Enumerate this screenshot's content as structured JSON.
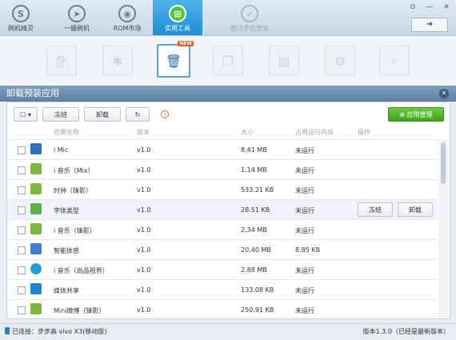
{
  "nav": {
    "items": [
      {
        "label": "刷机精灵"
      },
      {
        "label": "一键刷机"
      },
      {
        "label": "ROM市场"
      },
      {
        "label": "实用工具"
      },
      {
        "label": "腾讯手机管家"
      }
    ]
  },
  "panel": {
    "title": "卸载预装应用",
    "freeze_label": "冻结",
    "uninstall_label": "卸载",
    "manage_label": "应用管理"
  },
  "table": {
    "headers": [
      "应用名称",
      "版本",
      "大小",
      "占用运行内存",
      "操作"
    ],
    "rows": [
      {
        "name": "i Mic",
        "version": "v1.0",
        "size": "8.41 MB",
        "memory": "未运行"
      },
      {
        "name": "i 音乐（Mix）",
        "version": "v1.0",
        "size": "1.14 MB",
        "memory": "未运行"
      },
      {
        "name": "时钟（锋影）",
        "version": "v1.0",
        "size": "533.21 KB",
        "memory": "未运行"
      },
      {
        "name": "字体类型",
        "version": "v1.0",
        "size": "28.51 KB",
        "memory": "未运行",
        "freeze": "冻结",
        "uninstall": "卸载"
      },
      {
        "name": "i 音乐（锋影）",
        "version": "v1.0",
        "size": "2.34 MB",
        "memory": "未运行"
      },
      {
        "name": "智能体感",
        "version": "v1.0",
        "size": "20.40 MB",
        "memory": "8.85 KB"
      },
      {
        "name": "i 音乐（尚品视界）",
        "version": "v1.0",
        "size": "2.88 MB",
        "memory": "未运行"
      },
      {
        "name": "媒体共享",
        "version": "v1.0",
        "size": "133.08 KB",
        "memory": "未运行"
      },
      {
        "name": "Mini微博（锋影）",
        "version": "v1.0",
        "size": "250.91 KB",
        "memory": "未运行"
      }
    ]
  },
  "status": {
    "connection": "已连接：步步高 vivo X3(移动版)",
    "version": "版本1.3.0（已经是最新版本）"
  },
  "colors": {
    "accent": "#1f8fd6",
    "green": "#3ea41f",
    "panel_header": "#5d80a2"
  }
}
